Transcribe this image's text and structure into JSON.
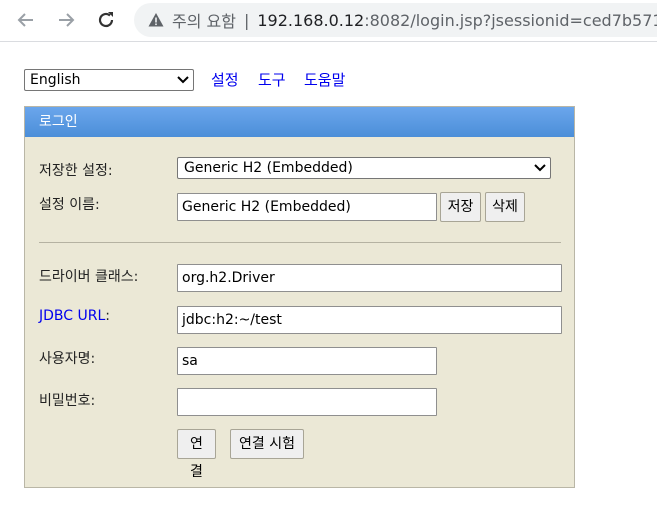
{
  "browser": {
    "warning_text": "주의 요함",
    "separator": "|",
    "url_host": "192.168.0.12",
    "url_rest": ":8082/login.jsp?jsessionid=ced7b571"
  },
  "language": {
    "selected": "English"
  },
  "top_links": {
    "settings": "설정",
    "tools": "도구",
    "help": "도움말"
  },
  "panel": {
    "title": "로그인",
    "saved_settings_label": "저장한 설정:",
    "saved_settings_value": "Generic H2 (Embedded)",
    "setting_name_label": "설정 이름:",
    "setting_name_value": "Generic H2 (Embedded)",
    "save_button": "저장",
    "delete_button": "삭제",
    "driver_class_label": "드라이버 클래스:",
    "driver_class_value": "org.h2.Driver",
    "jdbc_url_label": "JDBC URL",
    "jdbc_url_colon": ":",
    "jdbc_url_value": "jdbc:h2:~/test",
    "username_label": "사용자명:",
    "username_value": "sa",
    "password_label": "비밀번호:",
    "password_value": "",
    "connect_button": "연결",
    "test_button": "연결 시험"
  }
}
